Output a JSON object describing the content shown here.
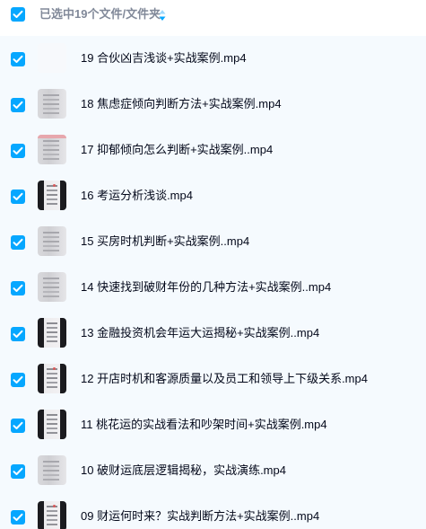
{
  "header": {
    "selection_label": "已选中19个文件/文件夹",
    "sort_icon": "sort-icon",
    "checkbox_checked": true
  },
  "colors": {
    "accent": "#06a7ff",
    "header_text": "#818999",
    "file_text": "#03081a",
    "list_background": "#f5fafe"
  },
  "files": [
    {
      "name": "19 合伙凶吉浅谈+实战案例.mp4",
      "thumbnail": "blank"
    },
    {
      "name": "18 焦虑症倾向判断方法+实战案例.mp4",
      "thumbnail": "light"
    },
    {
      "name": "17 抑郁倾向怎么判断+实战案例..mp4",
      "thumbnail": "light-pink"
    },
    {
      "name": "16 考运分析浅谈.mp4",
      "thumbnail": "dark-red"
    },
    {
      "name": "15 买房时机判断+实战案例..mp4",
      "thumbnail": "light"
    },
    {
      "name": "14 快速找到破财年份的几种方法+实战案例..mp4",
      "thumbnail": "light"
    },
    {
      "name": "13 金融投资机会年运大运揭秘+实战案例..mp4",
      "thumbnail": "dark"
    },
    {
      "name": "12 开店时机和客源质量以及员工和领导上下级关系.mp4",
      "thumbnail": "dark-red"
    },
    {
      "name": "11 桃花运的实战看法和吵架时间+实战案例.mp4",
      "thumbnail": "dark"
    },
    {
      "name": "10 破财运底层逻辑揭秘，实战演练.mp4",
      "thumbnail": "light"
    },
    {
      "name": "09 财运何时来？实战判断方法+实战案例..mp4",
      "thumbnail": "dark-red"
    }
  ]
}
